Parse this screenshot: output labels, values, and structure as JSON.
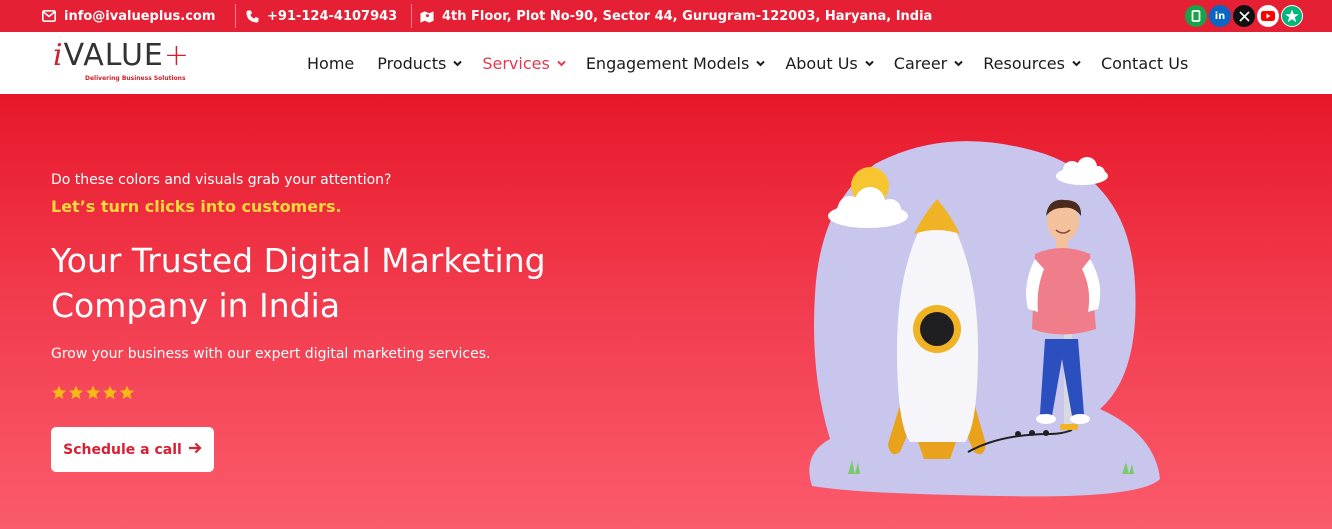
{
  "topbar": {
    "email": "info@ivalueplus.com",
    "phone": "+91-124-4107943",
    "address": "4th Floor, Plot No-90, Sector 44, Gurugram-122003, Haryana, India",
    "social": [
      {
        "icon": "clutch-icon",
        "color": "#17a34a"
      },
      {
        "icon": "linkedin-icon",
        "color": "#0a66c2"
      },
      {
        "icon": "x-icon",
        "color": "#111111"
      },
      {
        "icon": "youtube-icon",
        "color": "#ff0000"
      },
      {
        "icon": "trustpilot-icon",
        "color": "#00b67a"
      }
    ]
  },
  "logo": {
    "i": "i",
    "word": "VALUE",
    "plus": "+",
    "tagline": "Delivering Business Solutions"
  },
  "nav": {
    "items": [
      {
        "label": "Home",
        "dropdown": false,
        "active": false
      },
      {
        "label": "Products",
        "dropdown": true,
        "active": false
      },
      {
        "label": "Services",
        "dropdown": true,
        "active": true
      },
      {
        "label": "Engagement Models",
        "dropdown": true,
        "active": false
      },
      {
        "label": "About Us",
        "dropdown": true,
        "active": false
      },
      {
        "label": "Career",
        "dropdown": true,
        "active": false
      },
      {
        "label": "Resources",
        "dropdown": true,
        "active": false
      },
      {
        "label": "Contact Us",
        "dropdown": false,
        "active": false
      }
    ]
  },
  "hero": {
    "eyebrow": "Do these colors and visuals grab your attention?",
    "tagline": "Let’s turn clicks into customers.",
    "headline": "Your Trusted Digital Marketing Company in India",
    "subtext": "Grow your business with our expert digital marketing services.",
    "rating": 5,
    "rating_max": 5,
    "cta_label": "Schedule a call",
    "cta_icon": "arrow-right-icon"
  },
  "colors": {
    "brand_red": "#e51f34",
    "accent_yellow": "#ffd93b",
    "nav_active": "#e23b4f",
    "star": "#f7b916"
  }
}
